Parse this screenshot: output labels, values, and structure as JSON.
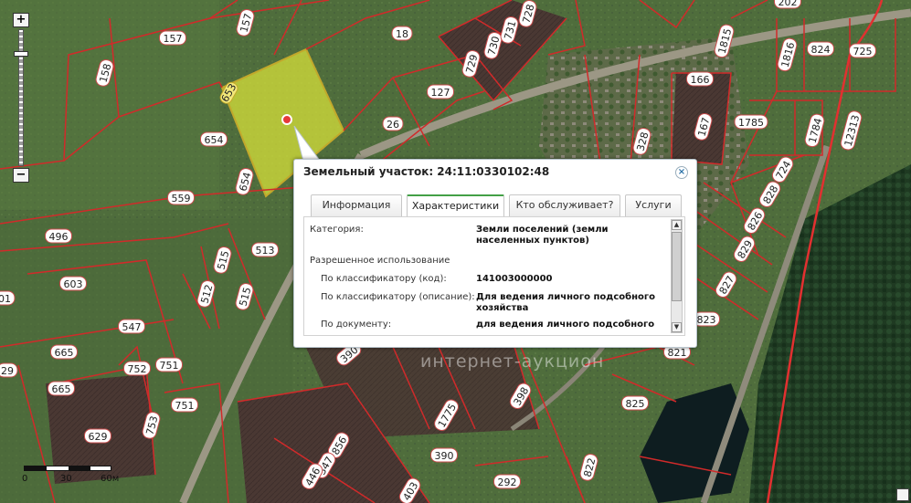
{
  "map": {
    "selected_plot_label": "653",
    "plots": [
      {
        "id": "p157",
        "label": "157"
      },
      {
        "id": "p157b",
        "label": "157"
      },
      {
        "id": "p158",
        "label": "158"
      },
      {
        "id": "p18",
        "label": "18"
      },
      {
        "id": "p127",
        "label": "127"
      },
      {
        "id": "p26",
        "label": "26"
      },
      {
        "id": "p654",
        "label": "654"
      },
      {
        "id": "p654b",
        "label": "654"
      },
      {
        "id": "p559",
        "label": "559"
      },
      {
        "id": "p496",
        "label": "496"
      },
      {
        "id": "p603",
        "label": "603"
      },
      {
        "id": "p547",
        "label": "547"
      },
      {
        "id": "p665",
        "label": "665"
      },
      {
        "id": "p665b",
        "label": "665"
      },
      {
        "id": "p752",
        "label": "752"
      },
      {
        "id": "p751",
        "label": "751"
      },
      {
        "id": "p751b",
        "label": "751"
      },
      {
        "id": "p753",
        "label": "753"
      },
      {
        "id": "p629",
        "label": "629"
      },
      {
        "id": "p515",
        "label": "515"
      },
      {
        "id": "p515b",
        "label": "515"
      },
      {
        "id": "p512",
        "label": "512"
      },
      {
        "id": "p513",
        "label": "513"
      },
      {
        "id": "p729",
        "label": "729"
      },
      {
        "id": "p730",
        "label": "730"
      },
      {
        "id": "p731",
        "label": "731"
      },
      {
        "id": "p728",
        "label": "728"
      },
      {
        "id": "p1815",
        "label": "1815"
      },
      {
        "id": "p202",
        "label": "202"
      },
      {
        "id": "p166",
        "label": "166"
      },
      {
        "id": "p167",
        "label": "167"
      },
      {
        "id": "p328",
        "label": "328"
      },
      {
        "id": "p1816",
        "label": "1816"
      },
      {
        "id": "p824",
        "label": "824"
      },
      {
        "id": "p725",
        "label": "725"
      },
      {
        "id": "p1785",
        "label": "1785"
      },
      {
        "id": "p1784",
        "label": "1784"
      },
      {
        "id": "p12313",
        "label": "12313"
      },
      {
        "id": "p724",
        "label": "724"
      },
      {
        "id": "p828",
        "label": "828"
      },
      {
        "id": "p826",
        "label": "826"
      },
      {
        "id": "p829",
        "label": "829"
      },
      {
        "id": "p827",
        "label": "827"
      },
      {
        "id": "p823",
        "label": "823"
      },
      {
        "id": "p821",
        "label": "821"
      },
      {
        "id": "p825",
        "label": "825"
      },
      {
        "id": "p822",
        "label": "822"
      },
      {
        "id": "p390",
        "label": "390"
      },
      {
        "id": "p390b",
        "label": "390"
      },
      {
        "id": "p398",
        "label": "398"
      },
      {
        "id": "p1775",
        "label": "1775"
      },
      {
        "id": "p856",
        "label": "856"
      },
      {
        "id": "p347",
        "label": "347"
      },
      {
        "id": "p446",
        "label": "446"
      },
      {
        "id": "p403",
        "label": "403"
      },
      {
        "id": "p292",
        "label": "292"
      },
      {
        "id": "p29",
        "label": "29"
      },
      {
        "id": "p01",
        "label": "01"
      }
    ]
  },
  "zoom": {
    "plus": "+",
    "minus": "−",
    "level": 0.24
  },
  "scale": {
    "t0": "0",
    "t1": "30",
    "t2": "60м"
  },
  "popup": {
    "title": "Земельный участок: 24:11:0330102:48",
    "close_label": "×",
    "tabs": [
      {
        "label": "Информация",
        "active": false
      },
      {
        "label": "Характеристики",
        "active": true
      },
      {
        "label": "Кто обслуживает?",
        "active": false
      },
      {
        "label": "Услуги",
        "active": false
      }
    ],
    "content": {
      "category_label": "Категория:",
      "category_value": "Земли поселений (земли населенных пунктов)",
      "permitted_use_label": "Разрешенное использование",
      "code_label": "По классификатору (код):",
      "code_value": "141003000000",
      "desc_label": "По классификатору (описание):",
      "desc_value": "Для ведения личного подсобного хозяйства",
      "doc_label": "По документу:",
      "doc_value": "для ведения личного подсобного"
    },
    "scroll_up": "▲",
    "scroll_down": "▼"
  },
  "watermark": "интернет-аукцион",
  "colors": {
    "boundary": "#d12a2a",
    "selected_fill": "#d6e03a",
    "popup_border": "#b8c4cc",
    "tab_accent": "#43a047"
  }
}
